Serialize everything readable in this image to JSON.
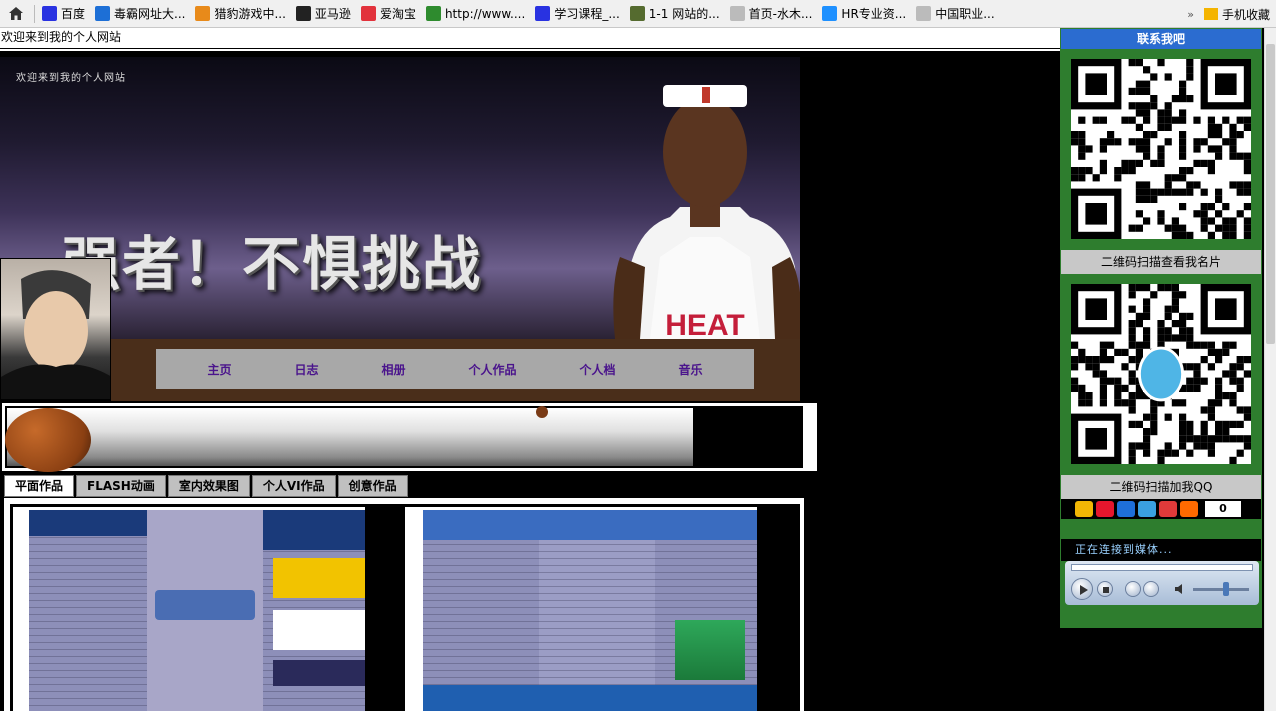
{
  "browser": {
    "bookmarks": [
      {
        "label": "百度",
        "icon": "baidu-icon",
        "color": "#2932e1"
      },
      {
        "label": "毒霸网址大...",
        "icon": "duba-icon",
        "color": "#1d6fd6"
      },
      {
        "label": "猎豹游戏中...",
        "icon": "liebao-icon",
        "color": "#e88a1a"
      },
      {
        "label": "亚马逊",
        "icon": "amazon-icon",
        "color": "#222222"
      },
      {
        "label": "爱淘宝",
        "icon": "taobao-icon",
        "color": "#e2323c"
      },
      {
        "label": "http://www....",
        "icon": "page-grid-icon",
        "color": "#2e8b2e"
      },
      {
        "label": "学习课程_...",
        "icon": "baidu-icon",
        "color": "#2932e1"
      },
      {
        "label": "1-1 网站的...",
        "icon": "shield-icon",
        "color": "#556b2f"
      },
      {
        "label": "首页-水木...",
        "icon": "page-icon",
        "color": "#bbbbbb"
      },
      {
        "label": "HR专业资...",
        "icon": "hr-icon",
        "color": "#1e90ff"
      },
      {
        "label": "中国职业...",
        "icon": "page-icon",
        "color": "#bbbbbb"
      }
    ],
    "more_chevron": "»",
    "favorites_label": "手机收藏"
  },
  "page": {
    "title_line": "欢迎来到我的个人网站"
  },
  "banner": {
    "welcome": "欢迎来到我的个人网站",
    "slogan": "强者！不惧挑战",
    "jersey_text": "HEAT"
  },
  "nav": [
    "主页",
    "日志",
    "相册",
    "个人作品",
    "个人档",
    "音乐"
  ],
  "tabs": [
    "平面作品",
    "FLASH动画",
    "室内效果图",
    "个人VI作品",
    "创意作品"
  ],
  "sidebar": {
    "header": "联系我吧",
    "qr1_caption": "二维码扫描查看我名片",
    "qr2_caption": "二维码扫描加我QQ",
    "share_count": "0",
    "media_status": "正在连接到媒体..."
  }
}
